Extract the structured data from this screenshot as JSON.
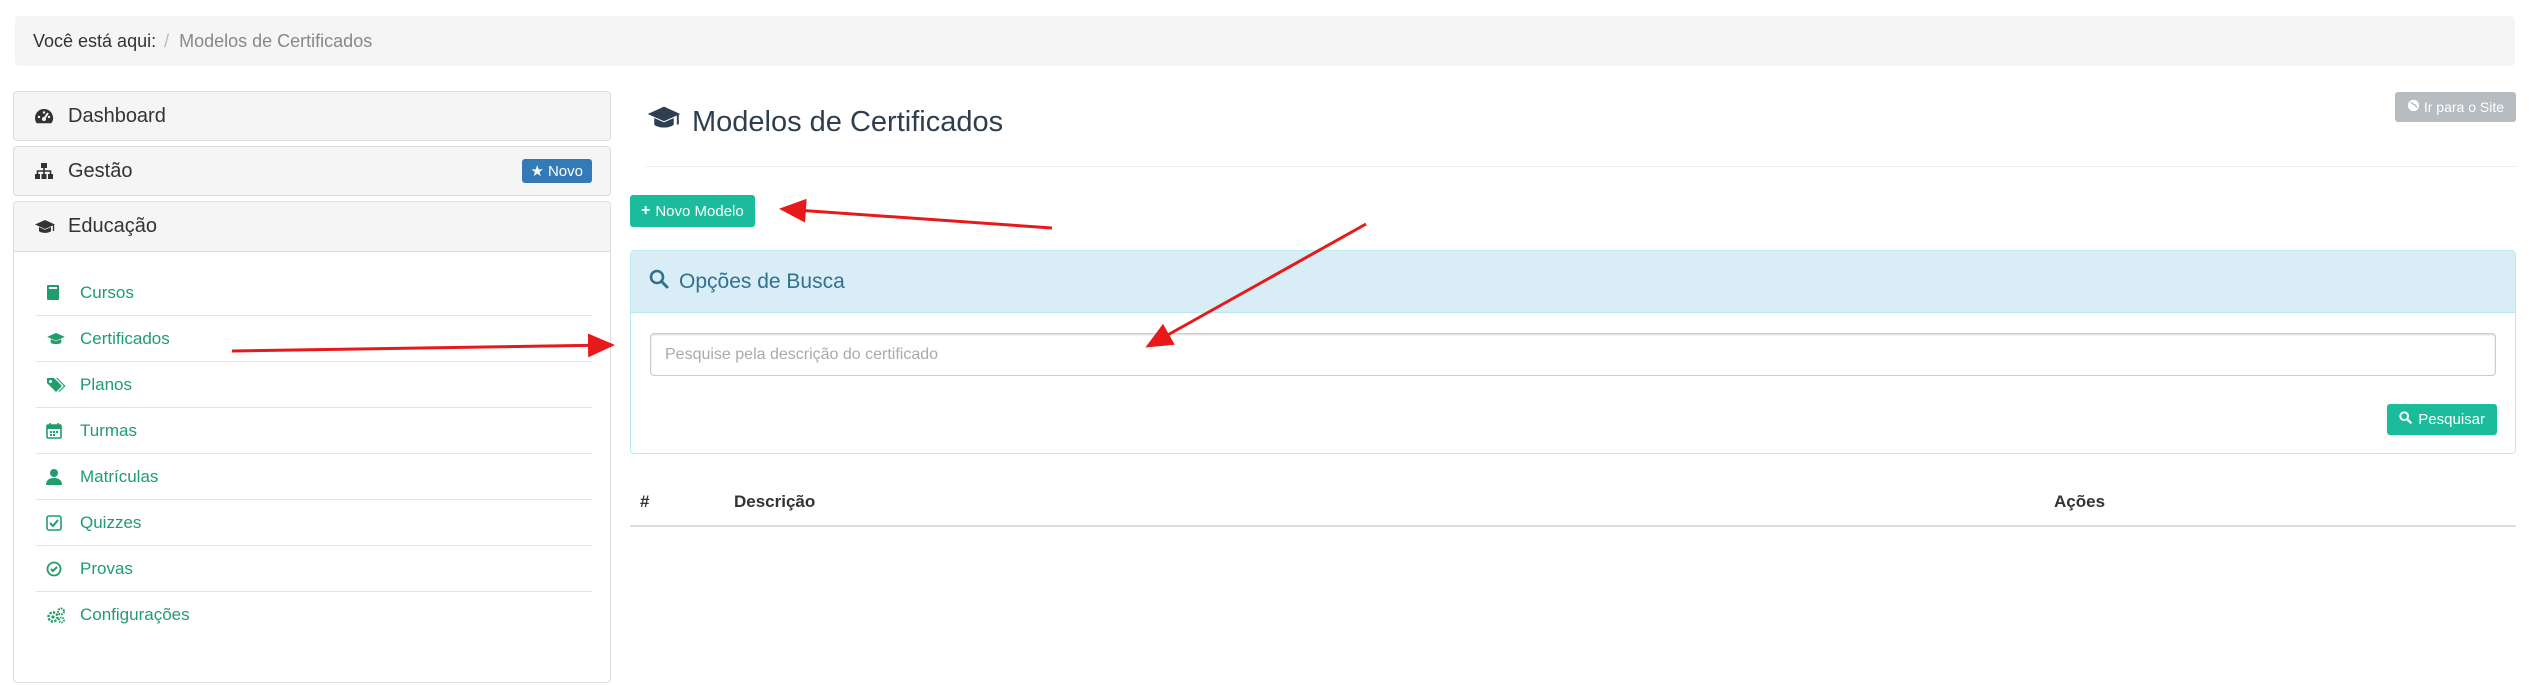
{
  "breadcrumb": {
    "prefix": "Você está aqui:",
    "separator": "/",
    "current": "Modelos de Certificados"
  },
  "sidebar": {
    "dashboard": {
      "label": "Dashboard",
      "icon": "dashboard-icon"
    },
    "gestao": {
      "label": "Gestão",
      "icon": "sitemap-icon",
      "badge": "Novo",
      "badge_icon": "star-icon"
    },
    "educacao": {
      "label": "Educação",
      "icon": "graduation-cap-icon",
      "items": [
        {
          "label": "Cursos",
          "icon": "book-icon"
        },
        {
          "label": "Certificados",
          "icon": "graduation-cap-icon"
        },
        {
          "label": "Planos",
          "icon": "tags-icon"
        },
        {
          "label": "Turmas",
          "icon": "calendar-icon"
        },
        {
          "label": "Matrículas",
          "icon": "user-icon"
        },
        {
          "label": "Quizzes",
          "icon": "check-square-icon"
        },
        {
          "label": "Provas",
          "icon": "check-circle-icon"
        },
        {
          "label": "Configurações",
          "icon": "cogs-icon"
        }
      ]
    }
  },
  "main": {
    "title": "Modelos de Certificados",
    "site_button": "Ir para o Site",
    "new_button": "Novo Modelo",
    "search": {
      "heading": "Opções de Busca",
      "placeholder": "Pesquise pela descrição do certificado",
      "value": "",
      "button": "Pesquisar"
    },
    "table": {
      "columns": [
        "#",
        "Descrição",
        "Ações"
      ],
      "rows": []
    }
  },
  "colors": {
    "accent_green": "#1abc9c",
    "link_green": "#1f9d6c",
    "badge_blue": "#337ab7",
    "info_bg": "#d9edf7",
    "info_text": "#31708f",
    "annotation_red": "#e8191a"
  }
}
